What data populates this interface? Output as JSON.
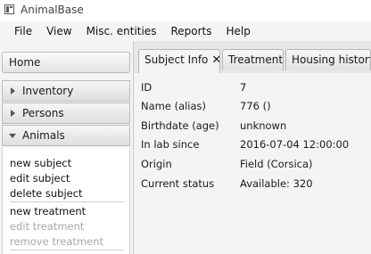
{
  "window": {
    "title": "AnimalBase"
  },
  "menu": [
    "File",
    "View",
    "Misc. entities",
    "Reports",
    "Help"
  ],
  "sidebar": {
    "home": "Home",
    "sections": [
      {
        "label": "Inventory",
        "expanded": false
      },
      {
        "label": "Persons",
        "expanded": false
      },
      {
        "label": "Animals",
        "expanded": true
      }
    ],
    "actions": [
      {
        "label": "new subject",
        "enabled": true
      },
      {
        "label": "edit subject",
        "enabled": true
      },
      {
        "label": "delete subject",
        "enabled": true
      },
      {
        "label": "new treatment",
        "enabled": true
      },
      {
        "label": "edit treatment",
        "enabled": false
      },
      {
        "label": "remove treatment",
        "enabled": false
      }
    ]
  },
  "tabs": [
    {
      "label": "Subject Info",
      "active": true,
      "closable": true,
      "close_glyph": "✕"
    },
    {
      "label": "Treatments",
      "active": false
    },
    {
      "label": "Housing history",
      "active": false
    }
  ],
  "details": [
    {
      "label": "ID",
      "value": "7"
    },
    {
      "label": "Name (alias)",
      "value": "776 ()"
    },
    {
      "label": "Birthdate (age)",
      "value": "unknown"
    },
    {
      "label": "In lab since",
      "value": "2016-07-04 12:00:00"
    },
    {
      "label": "Origin",
      "value": "Field (Corsica)"
    },
    {
      "label": "Current status",
      "value": "Available: 320"
    }
  ]
}
